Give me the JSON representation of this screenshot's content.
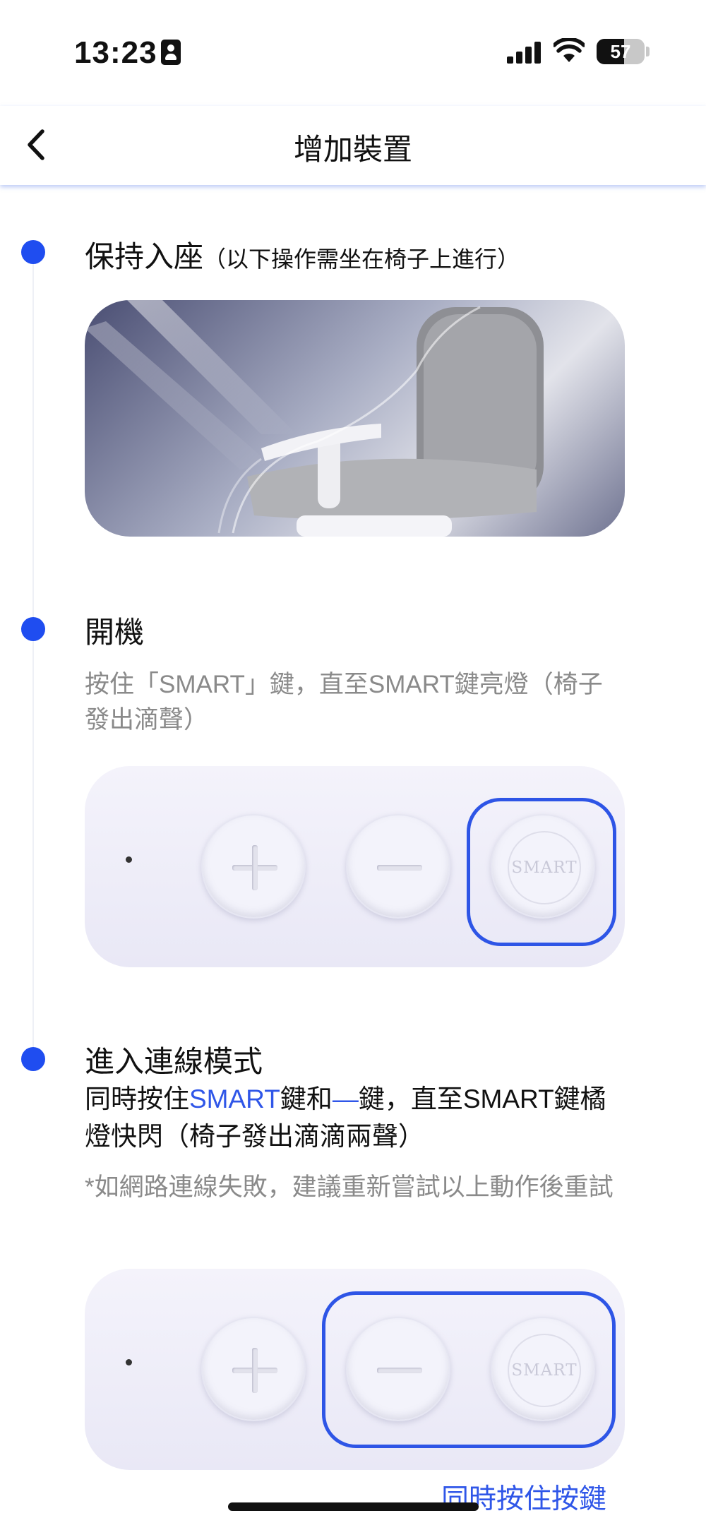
{
  "status_bar": {
    "time": "13:23",
    "battery_level": "57",
    "battery_fraction": 0.57,
    "icons": [
      "contact-card-icon",
      "cellular-signal-icon",
      "wifi-icon",
      "battery-icon"
    ]
  },
  "nav": {
    "title": "增加裝置",
    "back_icon": "chevron-left-icon"
  },
  "steps": [
    {
      "title": "保持入座",
      "note": "（以下操作需坐在椅子上進行）",
      "image": "chair-illustration"
    },
    {
      "title": "開機",
      "description": "按住「SMART」鍵，直至SMART鍵亮燈（椅子發出滴聲）",
      "image": "control-panel-smart-highlighted",
      "panel_buttons": [
        "plus-button",
        "minus-button",
        "smart-button"
      ],
      "smart_label": "SMART"
    },
    {
      "title": "進入連線模式",
      "instruction_parts": {
        "p1": "同時按住",
        "smart": "SMART",
        "p2": "鍵和",
        "minus": "—",
        "p3": "鍵，直至SMART鍵橘燈快閃（椅子發出滴滴兩聲）"
      },
      "hint": "*如網路連線失敗，建議重新嘗試以上動作後重試",
      "image": "control-panel-minus-smart-highlighted",
      "smart_label": "SMART",
      "footer_link": "同時按住按鍵"
    }
  ],
  "colors": {
    "accent": "#1f4df0",
    "link": "#2f56e8",
    "muted_text": "#8a8a8a"
  }
}
